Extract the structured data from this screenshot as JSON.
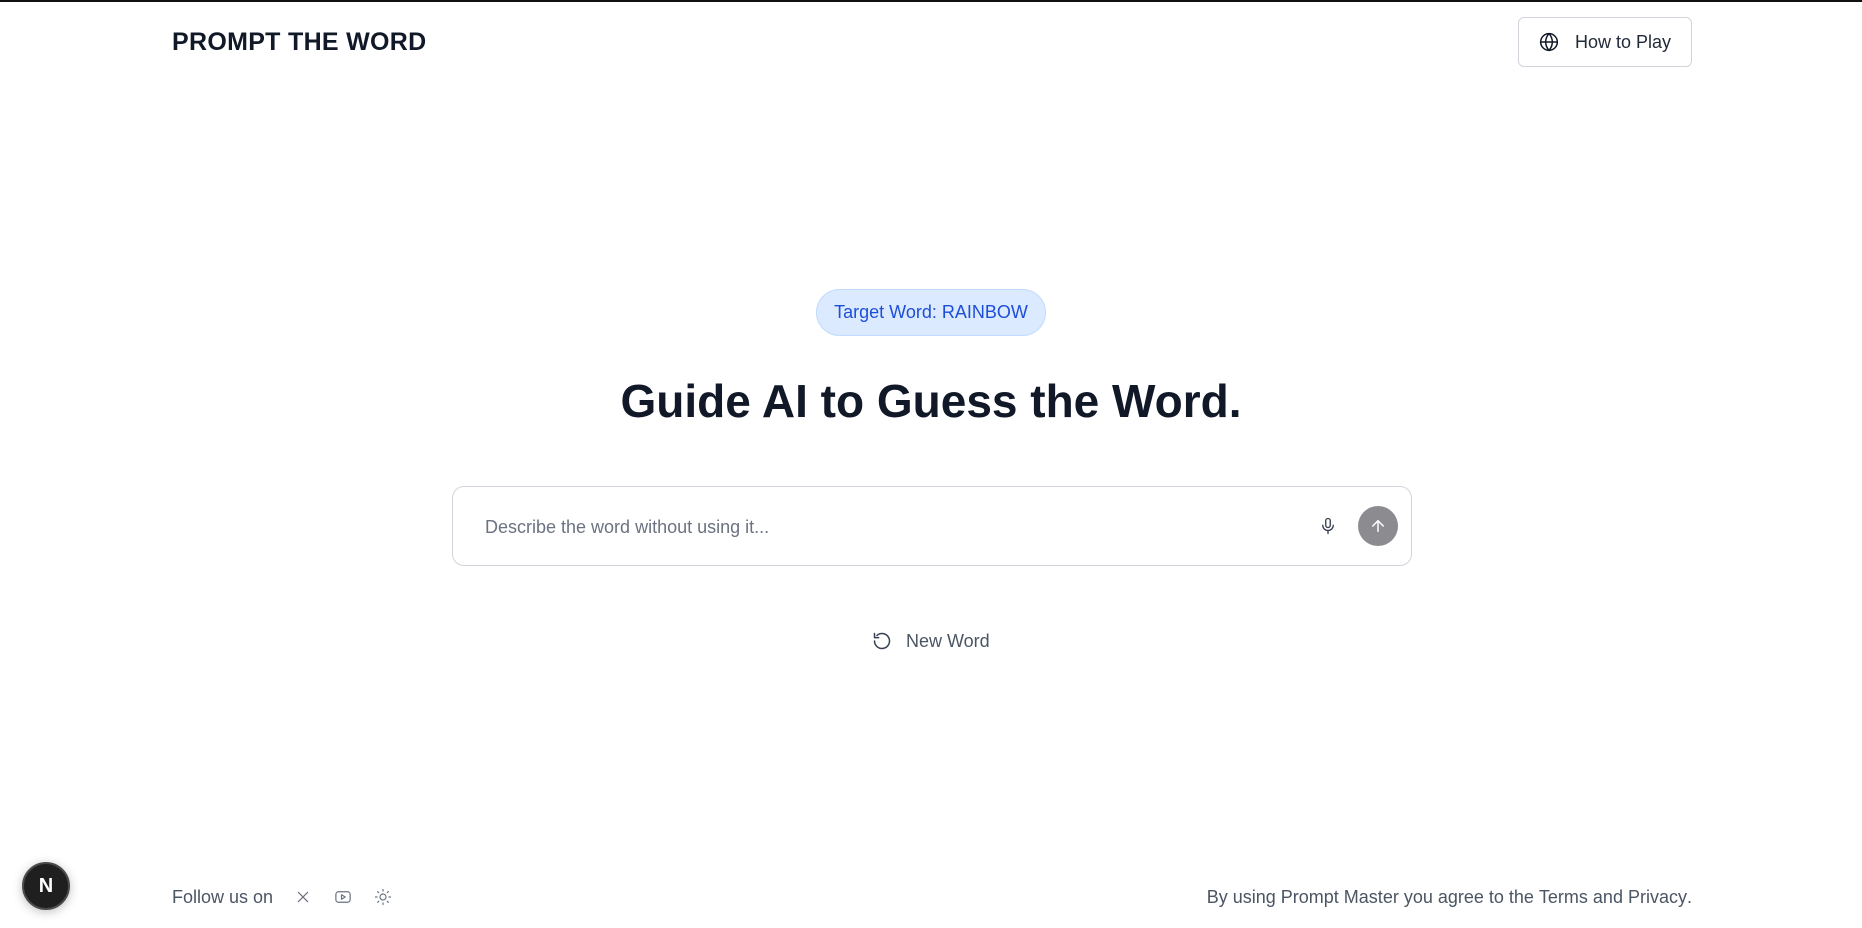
{
  "header": {
    "logo": "PROMPT THE WORD",
    "how_to_play_label": "How to Play",
    "how_to_play_icon": "globe-icon"
  },
  "main": {
    "target_word_label": "Target Word: RAINBOW",
    "headline": "Guide AI to Guess the Word.",
    "prompt_placeholder": "Describe the word without using it...",
    "prompt_value": "",
    "mic_icon": "microphone-icon",
    "send_icon": "arrow-up-icon",
    "new_word_label": "New Word",
    "new_word_icon": "refresh-icon"
  },
  "footer": {
    "follow_label": "Follow us on",
    "social_icons": [
      "x-icon",
      "youtube-icon",
      "sun-icon"
    ],
    "legal_prefix": "By using Prompt Master you agree to the ",
    "terms_label": "Terms",
    "legal_and": " and ",
    "privacy_label": "Privacy",
    "legal_suffix": "."
  },
  "badge": {
    "letter": "N"
  },
  "colors": {
    "pill_bg": "#dbeafe",
    "pill_text": "#1d4ed8",
    "send_button": "#8b8b90",
    "text_primary": "#111827",
    "text_secondary": "#4b5563"
  }
}
